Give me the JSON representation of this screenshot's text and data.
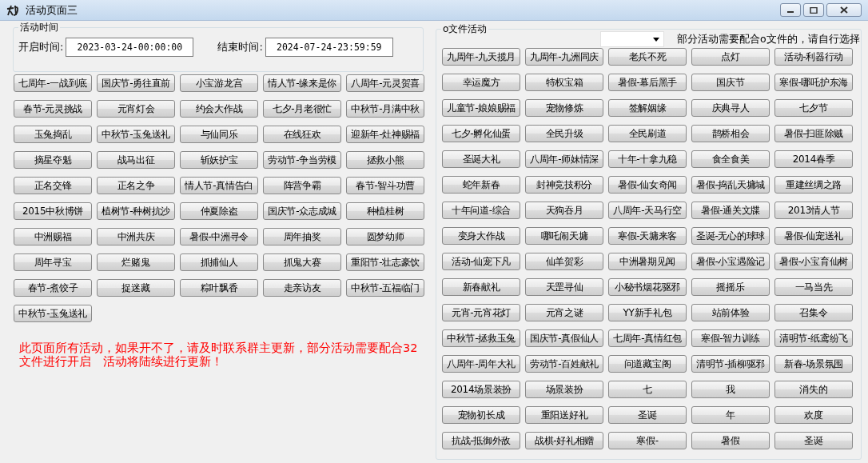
{
  "window": {
    "title": "活动页面三"
  },
  "time_group": {
    "title": "活动时间",
    "start_label": "开启时间:",
    "start_value": "2023-03-24-00:00:00",
    "end_label": "结束时间:",
    "end_value": "2024-07-24-23:59:59"
  },
  "activity_buttons": [
    "七周年-一战到底",
    "国庆节-勇往直前",
    "小宝游龙宫",
    "情人节-缘来是你",
    "八周年-元灵贺喜",
    "春节-元灵挑战",
    "元宵灯会",
    "约会大作战",
    "七夕-月老很忙",
    "中秋节-月满中秋",
    "玉兔捣乱",
    "中秋节-玉兔送礼",
    "与仙同乐",
    "在线狂欢",
    "迎新年-灶神赐福",
    "摘星夺魁",
    "战马出征",
    "斩妖护宝",
    "劳动节-争当劳模",
    "拯救小熊",
    "正名交锋",
    "正名之争",
    "情人节-真情告白",
    "阵营争霸",
    "春节-智斗功曹",
    "2015中秋博饼",
    "植树节-种树抗沙",
    "仲夏除盗",
    "国庆节-众志成城",
    "种植桂树",
    "中洲赐福",
    "中洲共庆",
    "暑假-中洲寻令",
    "周年抽奖",
    "圆梦幼师",
    "周年寻宝",
    "烂赌鬼",
    "抓捕仙人",
    "抓鬼大赛",
    "重阳节-壮志豪饮",
    "春节-煮饺子",
    "捉迷藏",
    "粽叶飘香",
    "走亲访友",
    "中秋节-五福临门",
    "中秋节-玉兔送礼"
  ],
  "notice": "此页面所有活动，如果开不了，请及时联系群主更新，部分活动需要配合32文件进行开启　活动将陆续进行更新！",
  "file_group": {
    "title": "o文件活动",
    "hint": "部分活动需要配合o文件的，请自行选择",
    "buttons": [
      "九周年-九天揽月",
      "九周年-九洲同庆",
      "老兵不死",
      "点灯",
      "活动-利器行动",
      "幸运魔方",
      "特权宝箱",
      "暑假-幕后黑手",
      "国庆节",
      "寒假-哪吒护东海",
      "儿童节-娘娘赐福",
      "宠物修炼",
      "签解姻缘",
      "庆典寻人",
      "七夕节",
      "七夕-孵化仙蛋",
      "全民升级",
      "全民刷道",
      "鹊桥相会",
      "暑假-扫匪除贼",
      "圣诞大礼",
      "八周年-师妹情深",
      "十年-十拿九稳",
      "食全食美",
      "2014春季",
      "蛇年新春",
      "封神竞技积分",
      "暑假-仙女奇闻",
      "暑假-捣乱天墉城",
      "重建丝绸之路",
      "十年问道-综合",
      "天狗吞月",
      "八周年-天马行空",
      "暑假-通关文牒",
      "2013情人节",
      "变身大作战",
      "哪吒闹天墉",
      "寒假-天墉来客",
      "圣诞-无心的球球",
      "暑假-仙宠送礼",
      "活动-仙宠下凡",
      "仙羊贺彩",
      "中洲暑期见闻",
      "暑假-小宝遇险记",
      "暑假-小宝育仙树",
      "新春献礼",
      "天罡寻仙",
      "小秘书烟花驱邪",
      "摇摇乐",
      "一马当先",
      "元宵-元宵花灯",
      "元宵之谜",
      "YY新手礼包",
      "站前体验",
      "召集令",
      "中秋节-拯救玉兔",
      "国庆节-真假仙人",
      "七周年-真情红包",
      "寒假-智力训练",
      "清明节-纸鸢纷飞",
      "八周年-周年大礼",
      "劳动节-百姓献礼",
      "问道藏宝阁",
      "清明节-插柳驱邪",
      "新春-场景氛围",
      "2014场景装扮",
      "场景装扮",
      "七",
      "我",
      "消失的",
      "宠物初长成",
      "重阳送好礼",
      "圣诞",
      "年",
      "欢度",
      "抗战-抵御外敌",
      "战棋-好礼相赠",
      "寒假-",
      "暑假",
      "圣诞"
    ]
  }
}
